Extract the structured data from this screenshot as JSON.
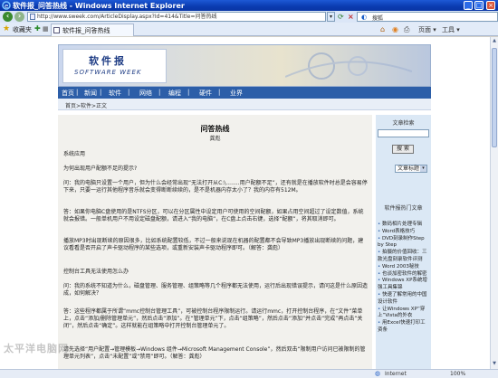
{
  "window": {
    "title": "软件报_问答热线 - Windows Internet Explorer",
    "min": "_",
    "max": "□",
    "close": "×"
  },
  "address": {
    "url": "http://www.sweek.com/ArticleDisplay.aspx?Id=414&Title=问答热线",
    "search_label": "搜狐"
  },
  "toolbar": {
    "favorites_label": "收藏夹",
    "tab_label": "软件报_问答热线",
    "page_label": "页面 ▾",
    "tools_label": "工具 ▾"
  },
  "site": {
    "logo_cn": "软件报",
    "logo_en": "SOFTWARE WEEK",
    "nav": [
      "首页",
      "新闻",
      "软件",
      "网络",
      "编程",
      "硬件",
      "业界"
    ],
    "nav_separator": "|",
    "breadcrumb": "首页>软件>正文"
  },
  "article": {
    "title": "问答热线",
    "author": "龚彪",
    "paragraphs": [
      "系统应用",
      "为何出现用户配额不足的提示?",
      "问：我的电脑只设置一个用户，但为什么会经常出现“无法打开从C:\\........用户配额不足”，还有就是在播放软件时总是会容易停下来，只要一运行其他程序音乐就会变得断断续续的，是不是机器内存太小了？我的内存有512M。",
      "答：如果你电脑C盘使用的是NTFS分区，可以在分区属性中设定用户可使用的空间配额，如果占用空间超过了设定数值，系统就会报错。一般单机用户不用设定磁盘配额，请进入“我的电脑”，在C盘上点击右键，选择“配额”，将其取消即可。",
      "播放MP3时出现断续的原因很多，比如系统配置较低，不过一般来说现在机器的配置都不会导致MP3播放出现断续的问题，建议看看是否开启了声卡驱动程序的某些选项，或重新安装声卡驱动程序即可。（解答：龚彪）",
      "控制台工具无法使用怎么办",
      "问：我的系统不知道为什么，磁盘管理、服务管理、组策略等几个程序都无法使用，运行后出现错误提示，请问这是什么原因造成，如何解决？",
      "答：这些程序都属于所谓“mmc控制台管理工具”，可被控制台程序限制运行。请运行mmc，打开控制台程序，在“文件”菜单上，点击“添加/删除管理单元”，然后点击“添加”。在“管理单元”下，点击“组策略”，然后点击“添加”并点击“完成”再点击“关闭”，然后点击“确定”。这样就能在组策略中打开控制台管理单元了。",
      "请先选择“用户配置→管理模板→Windows 组件→Microsoft Management Console”，然后双击“限制用户访问已被限制的管理单元列表”，点击“未配置”或“禁用”即可。（解答：龚彪）"
    ]
  },
  "sidebar": {
    "search_title": "文章检索",
    "search_button": "搜 索",
    "select_value": "文章标题",
    "hot_title": "软件报热门文章",
    "hot_items": [
      "数码相片处理专辑",
      "Word表格技巧",
      "DVD刻录制作Step by Step",
      "拍摄的价值回收：三款光盘刻录软件评测",
      "Word 2003秘技",
      "也谈加密软件的解密",
      "Windows XP系统增强工具集锦",
      "快速了解常用的中国设计软件",
      "让Windows XP“穿上”Vista的外衣",
      "用Excel快速打印工资条"
    ]
  },
  "watermark": "太平洋电脑网",
  "status": {
    "zone": "Internet",
    "zoom": "100%"
  }
}
